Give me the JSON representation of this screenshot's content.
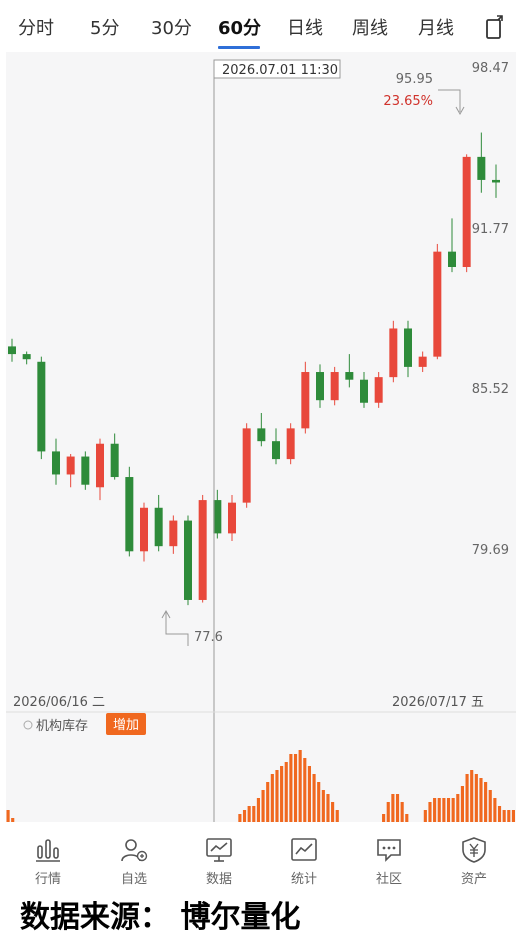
{
  "tabs": [
    {
      "label": "分时",
      "active": false
    },
    {
      "label": "5分",
      "active": false
    },
    {
      "label": "30分",
      "active": false
    },
    {
      "label": "60分",
      "active": true
    },
    {
      "label": "日线",
      "active": false
    },
    {
      "label": "周线",
      "active": false
    },
    {
      "label": "月线",
      "active": false
    }
  ],
  "rotate_icon": "rotate-screen-icon",
  "chart": {
    "crosshair_time": "2026.07.01 11:30",
    "start_date": "2026/06/16 二",
    "end_date": "2026/07/17 五",
    "price_axis": [
      "98.47",
      "91.77",
      "85.52",
      "79.69"
    ],
    "high_label": "95.95",
    "high_pct": "23.65%",
    "low_label": "77.6",
    "indicator_name": "机构库存",
    "indicator_button": "增加",
    "colors": {
      "up": "#e8483b",
      "down": "#2e8b3a",
      "volume": "#f0681f",
      "crosshair": "#999999",
      "accent": "#2f6fd8"
    }
  },
  "chart_data": {
    "type": "candlestick",
    "x_start": "2026/06/16",
    "x_end": "2026/07/17",
    "y_ticks": [
      98.47,
      91.77,
      85.52,
      79.69
    ],
    "high": 95.95,
    "low": 77.6,
    "candles": [
      [
        87.6,
        87.9,
        87.0,
        87.3
      ],
      [
        87.3,
        87.4,
        86.9,
        87.1
      ],
      [
        87.0,
        87.2,
        83.2,
        83.5
      ],
      [
        83.5,
        84.0,
        82.2,
        82.6
      ],
      [
        82.6,
        83.4,
        82.1,
        83.3
      ],
      [
        83.3,
        83.5,
        82.0,
        82.2
      ],
      [
        82.1,
        84.0,
        81.6,
        83.8
      ],
      [
        83.8,
        84.2,
        82.4,
        82.5
      ],
      [
        82.5,
        82.9,
        79.4,
        79.6
      ],
      [
        79.6,
        81.5,
        79.2,
        81.3
      ],
      [
        81.3,
        81.8,
        79.6,
        79.8
      ],
      [
        79.8,
        81.0,
        79.5,
        80.8
      ],
      [
        80.8,
        81.0,
        77.5,
        77.7
      ],
      [
        77.7,
        81.8,
        77.6,
        81.6
      ],
      [
        81.6,
        82.0,
        80.1,
        80.3
      ],
      [
        80.3,
        81.8,
        80.0,
        81.5
      ],
      [
        81.5,
        84.6,
        81.3,
        84.4
      ],
      [
        84.4,
        85.0,
        83.7,
        83.9
      ],
      [
        83.9,
        84.4,
        83.0,
        83.2
      ],
      [
        83.2,
        84.6,
        83.0,
        84.4
      ],
      [
        84.4,
        87.0,
        84.2,
        86.6
      ],
      [
        86.6,
        86.9,
        85.2,
        85.5
      ],
      [
        85.5,
        86.8,
        85.3,
        86.6
      ],
      [
        86.6,
        87.3,
        86.0,
        86.3
      ],
      [
        86.3,
        86.6,
        85.2,
        85.4
      ],
      [
        85.4,
        86.6,
        85.2,
        86.4
      ],
      [
        86.4,
        88.6,
        86.2,
        88.3
      ],
      [
        88.3,
        88.6,
        86.4,
        86.8
      ],
      [
        86.8,
        87.4,
        86.6,
        87.2
      ],
      [
        87.2,
        91.6,
        87.1,
        91.3
      ],
      [
        91.3,
        92.6,
        90.5,
        90.7
      ],
      [
        90.7,
        95.1,
        90.5,
        95.0
      ],
      [
        95.0,
        95.95,
        93.6,
        94.1
      ],
      [
        94.1,
        94.7,
        93.4,
        94.0
      ]
    ],
    "volume_series_name": "机构库存",
    "volume": [
      3,
      1,
      0,
      0,
      0,
      0,
      0,
      0,
      0,
      0,
      0,
      0,
      0,
      0,
      0,
      0,
      0,
      0,
      0,
      0,
      0,
      0,
      0,
      0,
      0,
      0,
      0,
      0,
      0,
      0,
      0,
      0,
      0,
      0,
      0,
      0,
      0,
      0,
      0,
      0,
      0,
      0,
      0,
      0,
      0,
      0,
      0,
      0,
      0,
      0,
      2,
      3,
      4,
      4,
      6,
      8,
      10,
      12,
      13,
      14,
      15,
      17,
      17,
      18,
      16,
      14,
      12,
      10,
      8,
      7,
      5,
      3,
      0,
      0,
      0,
      0,
      0,
      0,
      0,
      0,
      0,
      2,
      5,
      7,
      7,
      5,
      2,
      0,
      0,
      0,
      3,
      5,
      6,
      6,
      6,
      6,
      6,
      7,
      9,
      12,
      13,
      12,
      11,
      10,
      8,
      6,
      4,
      3,
      3,
      3
    ]
  },
  "bottom_nav": [
    {
      "label": "行情",
      "icon": "bar-chart-icon"
    },
    {
      "label": "自选",
      "icon": "user-add-icon"
    },
    {
      "label": "数据",
      "icon": "monitor-chart-icon"
    },
    {
      "label": "统计",
      "icon": "line-chart-icon"
    },
    {
      "label": "社区",
      "icon": "chat-bubble-icon"
    },
    {
      "label": "资产",
      "icon": "yuan-shield-icon"
    }
  ],
  "watermark": "数据来源： 博尔量化"
}
